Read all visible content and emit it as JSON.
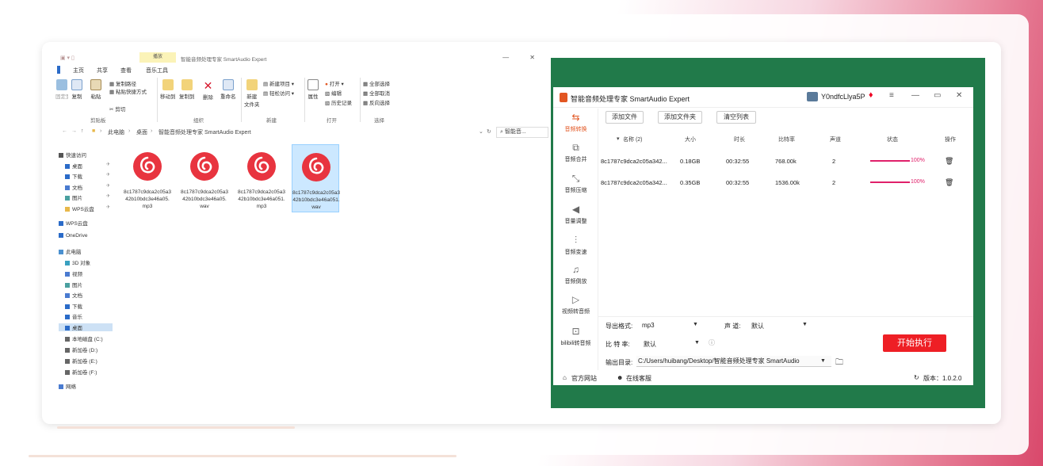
{
  "explorer": {
    "context_tab": "播放",
    "title": "智能音频处理专家 SmartAudio Expert",
    "tabs": [
      "主页",
      "共享",
      "查看",
      "音乐工具"
    ],
    "ribbon": {
      "pin": "固定到快速访问",
      "copy": "复制",
      "paste": "粘贴",
      "copy_path": "复制路径",
      "paste_shortcut": "粘贴快捷方式",
      "cut": "剪切",
      "clipboard_group": "剪贴板",
      "move_to": "移动到",
      "copy_to": "复制到",
      "delete": "删除",
      "rename": "重命名",
      "organize_group": "组织",
      "new_folder_line1": "新建",
      "new_folder_line2": "文件夹",
      "new_item": "新建项目",
      "easy_access": "轻松访问",
      "new_group": "新建",
      "properties": "属性",
      "open": "打开",
      "edit": "编辑",
      "history": "历史记录",
      "open_group": "打开",
      "select_all": "全部选择",
      "select_none": "全部取消",
      "invert_selection": "反向选择",
      "select_group": "选择"
    },
    "address": {
      "crumbs": [
        "此电脑",
        "桌面",
        "智能音频处理专家 SmartAudio Expert"
      ],
      "search_placeholder": "智能音..."
    },
    "nav": [
      {
        "label": "快速访问",
        "level": 0
      },
      {
        "label": "桌面",
        "level": 1,
        "pinned": true
      },
      {
        "label": "下载",
        "level": 1,
        "pinned": true
      },
      {
        "label": "文档",
        "level": 1,
        "pinned": true
      },
      {
        "label": "图片",
        "level": 1,
        "pinned": true
      },
      {
        "label": "WPS云盘",
        "level": 1,
        "pinned": true
      },
      {
        "label": "WPS云盘",
        "level": 0
      },
      {
        "label": "OneDrive",
        "level": 0
      },
      {
        "label": "此电脑",
        "level": 0
      },
      {
        "label": "3D 对象",
        "level": 1
      },
      {
        "label": "视频",
        "level": 1
      },
      {
        "label": "图片",
        "level": 1
      },
      {
        "label": "文档",
        "level": 1
      },
      {
        "label": "下载",
        "level": 1
      },
      {
        "label": "音乐",
        "level": 1
      },
      {
        "label": "桌面",
        "level": 1,
        "selected": true
      },
      {
        "label": "本地磁盘 (C:)",
        "level": 1
      },
      {
        "label": "新加卷 (D:)",
        "level": 1
      },
      {
        "label": "新加卷 (E:)",
        "level": 1
      },
      {
        "label": "新加卷 (F:)",
        "level": 1
      },
      {
        "label": "网络",
        "level": 0
      }
    ],
    "files": [
      {
        "name": "8c1787c9dca2c05a342b10bdc3e46a05.mp3",
        "selected": false
      },
      {
        "name": "8c1787c9dca2c05a342b10bdc3e46a05.wav",
        "selected": false
      },
      {
        "name": "8c1787c9dca2c05a342b10bdc3e46a051.mp3",
        "selected": false
      },
      {
        "name": "8c1787c9dca2c05a342b10bdc3e46a051.wav",
        "selected": true
      }
    ]
  },
  "app": {
    "title": "智能音频处理专家 SmartAudio Expert",
    "username": "Y0ndfcLlya5P",
    "sidebar": [
      "音频转换",
      "音频合并",
      "音频压缩",
      "音量调整",
      "音频变速",
      "音频倒放",
      "视频转音频",
      "bilibili转音频"
    ],
    "toolbar": {
      "add_file": "添加文件",
      "add_folder": "添加文件夹",
      "clear_list": "清空列表"
    },
    "table": {
      "headers": [
        "名称 (2)",
        "大小",
        "时长",
        "比特率",
        "声道",
        "状态",
        "操作"
      ],
      "rows": [
        {
          "name": "8c1787c9dca2c05a342...",
          "size": "0.18GB",
          "duration": "00:32:55",
          "bitrate": "768.00k",
          "channels": "2",
          "progress": "100%"
        },
        {
          "name": "8c1787c9dca2c05a342...",
          "size": "0.35GB",
          "duration": "00:32:55",
          "bitrate": "1536.00k",
          "channels": "2",
          "progress": "100%"
        }
      ]
    },
    "settings": {
      "format_label": "导出格式:",
      "format_value": "mp3",
      "channel_label": "声 道:",
      "channel_value": "默认",
      "bitrate_label": "比 特 率:",
      "bitrate_value": "默认",
      "output_label": "输出目录:",
      "output_value": "C:/Users/huibang/Desktop/智能音频处理专家 SmartAudio"
    },
    "start_button": "开始执行",
    "footer": {
      "website": "官方网站",
      "support": "在线客服",
      "version": "版本：1.0.2.0"
    }
  },
  "colors": {
    "accent": "#ee1f25",
    "brand_orange": "#e25622",
    "progress": "#e0206a",
    "app_background": "#217a4a"
  }
}
